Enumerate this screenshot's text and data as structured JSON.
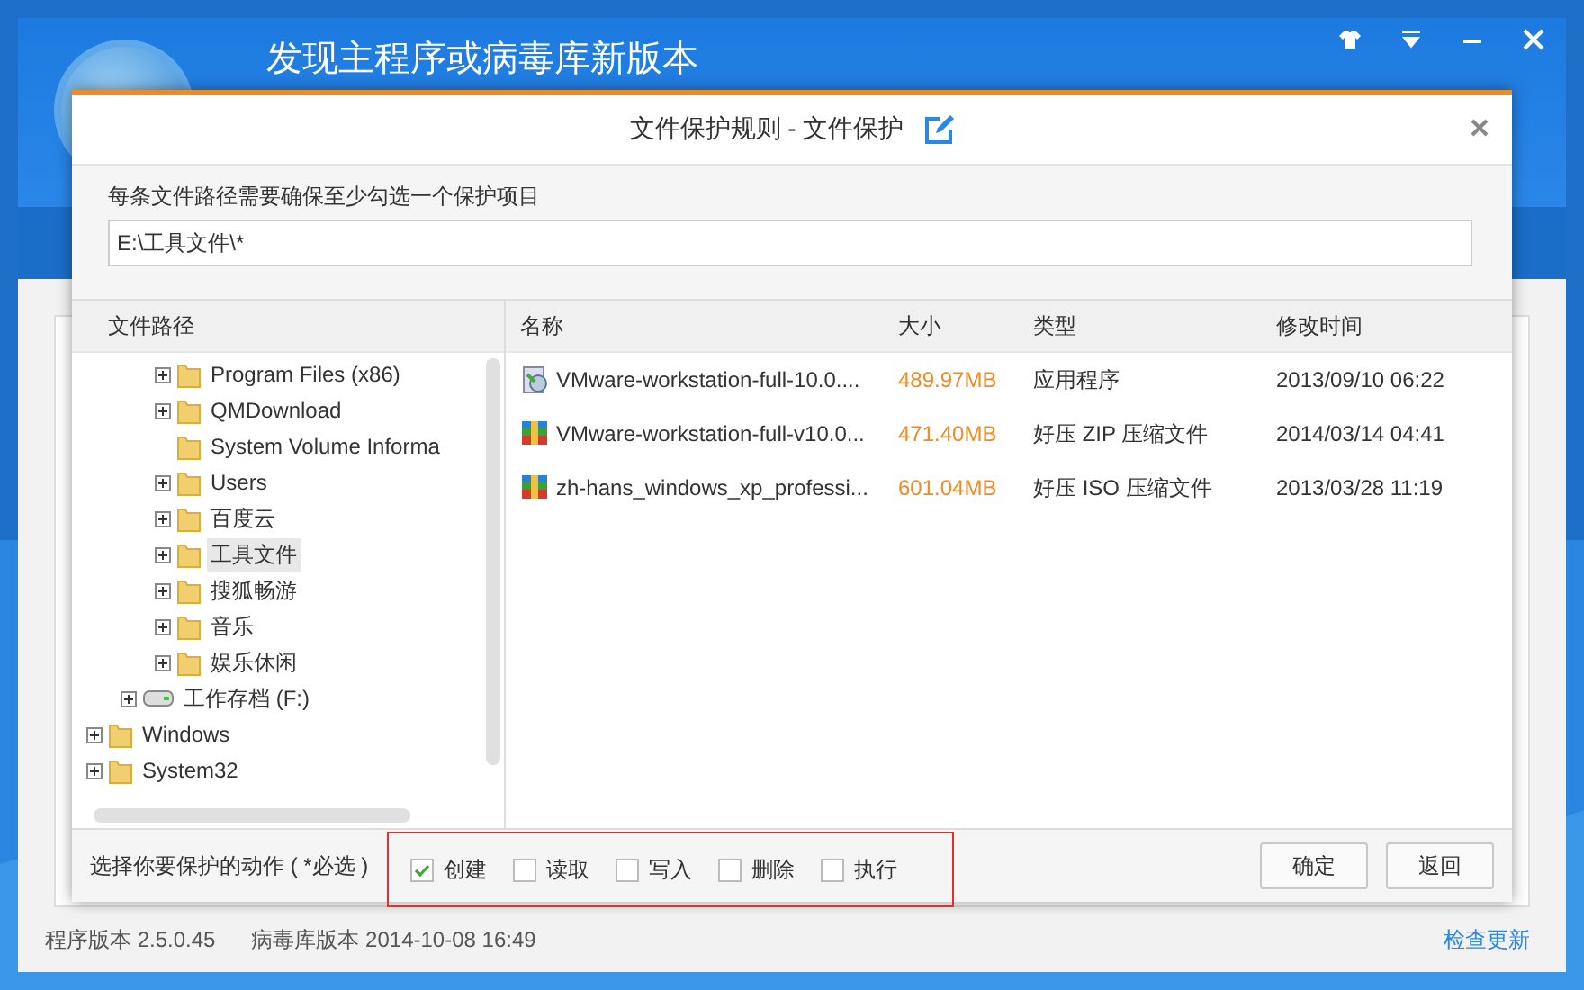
{
  "app": {
    "title": "发现主程序或病毒库新版本",
    "footer": {
      "version": "程序版本 2.5.0.45",
      "db_version": "病毒库版本 2014-10-08 16:49",
      "update_link": "检查更新"
    }
  },
  "dialog": {
    "title": "文件保护规则 - 文件保护",
    "hint": "每条文件路径需要确保至少勾选一个保护项目",
    "path_value": "E:\\工具文件\\*",
    "tree_header": "文件路径",
    "tree": [
      {
        "children": [
          {
            "children": [
              {
                "label": "Program Files (x86)",
                "expandable": true,
                "selected": false
              },
              {
                "label": "QMDownload",
                "expandable": true,
                "selected": false
              },
              {
                "label": "System Volume Informa",
                "expandable": false,
                "selected": false
              },
              {
                "label": "Users",
                "expandable": true,
                "selected": false
              },
              {
                "label": "百度云",
                "expandable": true,
                "selected": false
              },
              {
                "label": "工具文件",
                "expandable": true,
                "selected": true
              },
              {
                "label": "搜狐畅游",
                "expandable": true,
                "selected": false
              },
              {
                "label": "音乐",
                "expandable": true,
                "selected": false
              },
              {
                "label": "娱乐休闲",
                "expandable": true,
                "selected": false
              }
            ]
          },
          {
            "label": "工作存档 (F:)",
            "kind": "drive",
            "expandable": true,
            "selected": false
          }
        ]
      },
      {
        "label": "Windows",
        "expandable": true,
        "selected": false
      },
      {
        "label": "System32",
        "expandable": true,
        "selected": false
      }
    ],
    "columns": [
      "名称",
      "大小",
      "类型",
      "修改时间"
    ],
    "files": [
      {
        "kind": "app",
        "name": "VMware-workstation-full-10.0....",
        "size": "489.97MB",
        "type": "应用程序",
        "modified": "2013/09/10 06:22"
      },
      {
        "kind": "archive",
        "name": "VMware-workstation-full-v10.0...",
        "size": "471.40MB",
        "type": "好压 ZIP 压缩文件",
        "modified": "2014/03/14 04:41"
      },
      {
        "kind": "archive",
        "name": "zh-hans_windows_xp_professi...",
        "size": "601.04MB",
        "type": "好压 ISO 压缩文件",
        "modified": "2013/03/28 11:19"
      }
    ],
    "actions_label": "选择你要保护的动作 ( *必选 )",
    "actions_highlighted": true,
    "actions": [
      {
        "label": "创建",
        "checked": true
      },
      {
        "label": "读取",
        "checked": false
      },
      {
        "label": "写入",
        "checked": false
      },
      {
        "label": "删除",
        "checked": false
      },
      {
        "label": "执行",
        "checked": false
      }
    ],
    "buttons": [
      "确定",
      "返回"
    ]
  }
}
